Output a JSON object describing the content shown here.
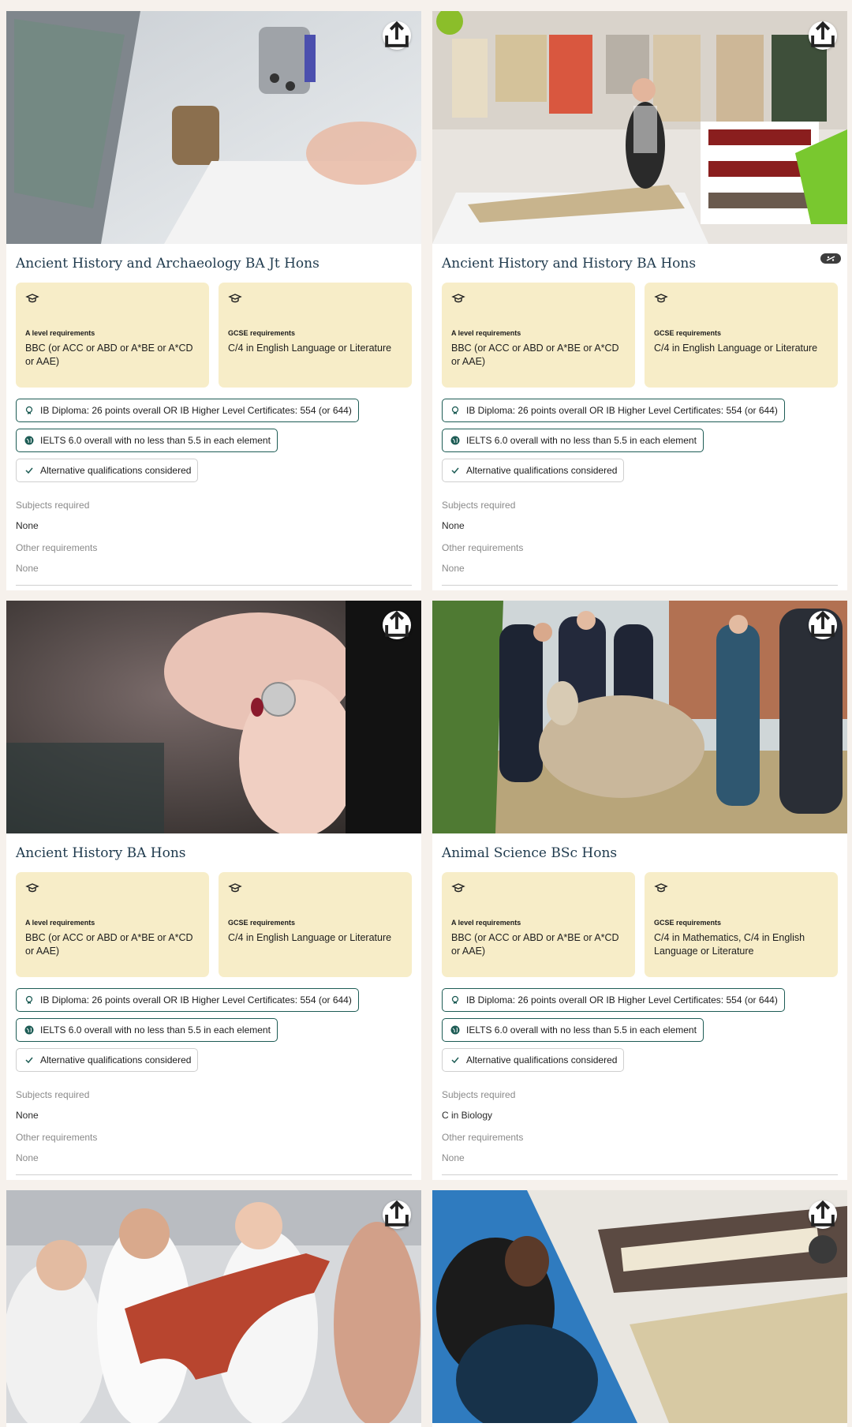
{
  "share_label": "Share",
  "cards": [
    {
      "title": "Ancient History and Archaeology BA Jt Hons",
      "a_level_label": "A level requirements",
      "a_level_value": "BBC (or ACC or ABD or A*BE or A*CD or AAE)",
      "gcse_label": "GCSE requirements",
      "gcse_value": "C/4 in English Language or Literature",
      "ib": "IB Diploma: 26 points overall OR IB Higher Level Certificates: 554 (or 644)",
      "ielts": "IELTS 6.0 overall with no less than 5.5 in each element",
      "alt": "Alternative qualifications considered",
      "subjects_label": "Subjects required",
      "subjects_value": "None",
      "other_label": "Other requirements",
      "other_value": "None"
    },
    {
      "title": "Ancient History and History BA Hons",
      "a_level_label": "A level requirements",
      "a_level_value": "BBC (or ACC or ABD or A*BE or A*CD or AAE)",
      "gcse_label": "GCSE requirements",
      "gcse_value": "C/4 in English Language or Literature",
      "ib": "IB Diploma: 26 points overall OR IB Higher Level Certificates: 554 (or 644)",
      "ielts": "IELTS 6.0 overall with no less than 5.5 in each element",
      "alt": "Alternative qualifications considered",
      "subjects_label": "Subjects required",
      "subjects_value": "None",
      "other_label": "Other requirements",
      "other_value": "None"
    },
    {
      "title": "Ancient History BA Hons",
      "a_level_label": "A level requirements",
      "a_level_value": "BBC (or ACC or ABD or A*BE or A*CD or AAE)",
      "gcse_label": "GCSE requirements",
      "gcse_value": "C/4 in English Language or Literature",
      "ib": "IB Diploma: 26 points overall OR IB Higher Level Certificates: 554 (or 644)",
      "ielts": "IELTS 6.0 overall with no less than 5.5 in each element",
      "alt": "Alternative qualifications considered",
      "subjects_label": "Subjects required",
      "subjects_value": "None",
      "other_label": "Other requirements",
      "other_value": "None"
    },
    {
      "title": "Animal Science BSc Hons",
      "a_level_label": "A level requirements",
      "a_level_value": "BBC (or ACC or ABD or A*BE or A*CD or AAE)",
      "gcse_label": "GCSE requirements",
      "gcse_value": "C/4 in Mathematics, C/4 in English Language or Literature",
      "ib": "IB Diploma: 26 points overall OR IB Higher Level Certificates: 554 (or 644)",
      "ielts": "IELTS 6.0 overall with no less than 5.5 in each element",
      "alt": "Alternative qualifications considered",
      "subjects_label": "Subjects required",
      "subjects_value": "C in Biology",
      "other_label": "Other requirements",
      "other_value": "None"
    }
  ],
  "colors": {
    "page_bg": "#f6f1ec",
    "title": "#1f3a4d",
    "req_box": "#f7edc8",
    "pill_border": "#1d5c55",
    "muted": "#8a8a8a"
  },
  "icons": {
    "share": "share-icon",
    "requirements": "graduation-cap-icon",
    "ib": "ib-badge-icon",
    "ielts": "globe-icon",
    "alt": "check-icon"
  }
}
